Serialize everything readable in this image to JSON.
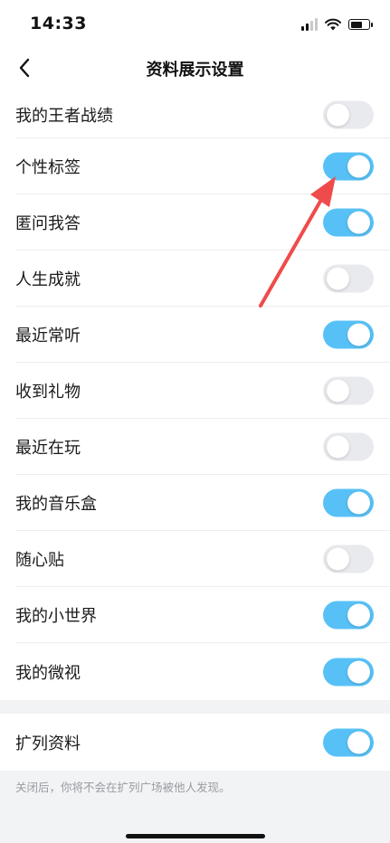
{
  "status_bar": {
    "time": "14:33"
  },
  "nav": {
    "title": "资料展示设置"
  },
  "settings": [
    {
      "label": "我的王者战绩",
      "on": false
    },
    {
      "label": "个性标签",
      "on": true
    },
    {
      "label": "匿问我答",
      "on": true
    },
    {
      "label": "人生成就",
      "on": false
    },
    {
      "label": "最近常听",
      "on": true
    },
    {
      "label": "收到礼物",
      "on": false
    },
    {
      "label": "最近在玩",
      "on": false
    },
    {
      "label": "我的音乐盒",
      "on": true
    },
    {
      "label": "随心贴",
      "on": false
    },
    {
      "label": "我的小世界",
      "on": true
    },
    {
      "label": "我的微视",
      "on": true
    }
  ],
  "expand": {
    "label": "扩列资料",
    "on": true
  },
  "footnote": "关闭后，你将不会在扩列广场被他人发现。",
  "colors": {
    "toggle_on": "#57c1f7",
    "toggle_off": "#e9eaee",
    "arrow": "#f04b4b"
  }
}
